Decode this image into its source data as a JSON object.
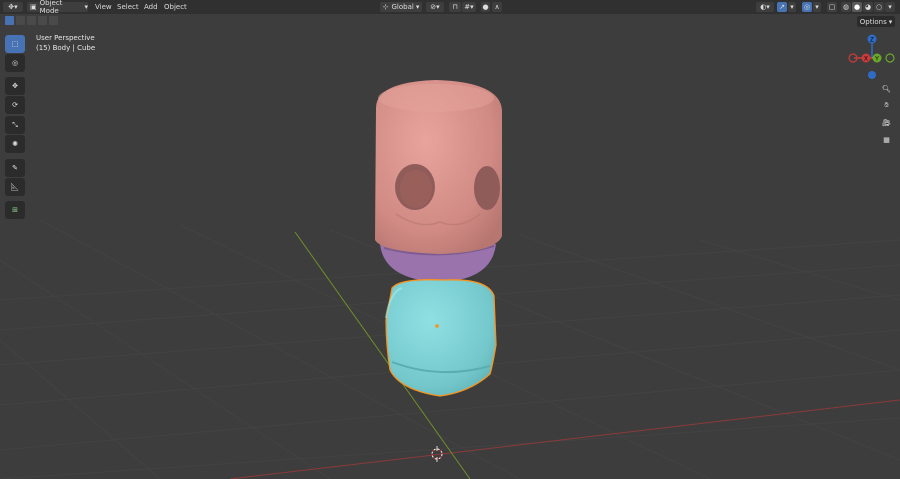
{
  "header": {
    "mode_label": "Object Mode",
    "menu": [
      "View",
      "Select",
      "Add",
      "Object"
    ],
    "orientation_label": "Global",
    "options_label": "Options"
  },
  "viewport": {
    "view_name": "User Perspective",
    "object_info": "(15) Body | Cube"
  },
  "gizmo": {
    "x_label": "X",
    "y_label": "Y",
    "z_label": "Z"
  },
  "colors": {
    "background": "#3d3d3d",
    "header": "#303030",
    "head": "#d68f8a",
    "mouth": "#9a73ad",
    "body": "#7ecfd3",
    "selection_outline": "#f7931e",
    "x_axis": "#8b3a3a",
    "y_axis": "#6d8f2b",
    "active_button": "#4772b3"
  },
  "icons": {
    "toolbar": [
      "select-box-icon",
      "cursor-icon",
      "move-icon",
      "rotate-icon",
      "scale-icon",
      "transform-icon",
      "annotate-icon",
      "measure-icon",
      "add-cube-icon"
    ],
    "navigation": [
      "zoom-icon",
      "pan-hand-icon",
      "camera-icon",
      "grid-view-icon"
    ]
  }
}
